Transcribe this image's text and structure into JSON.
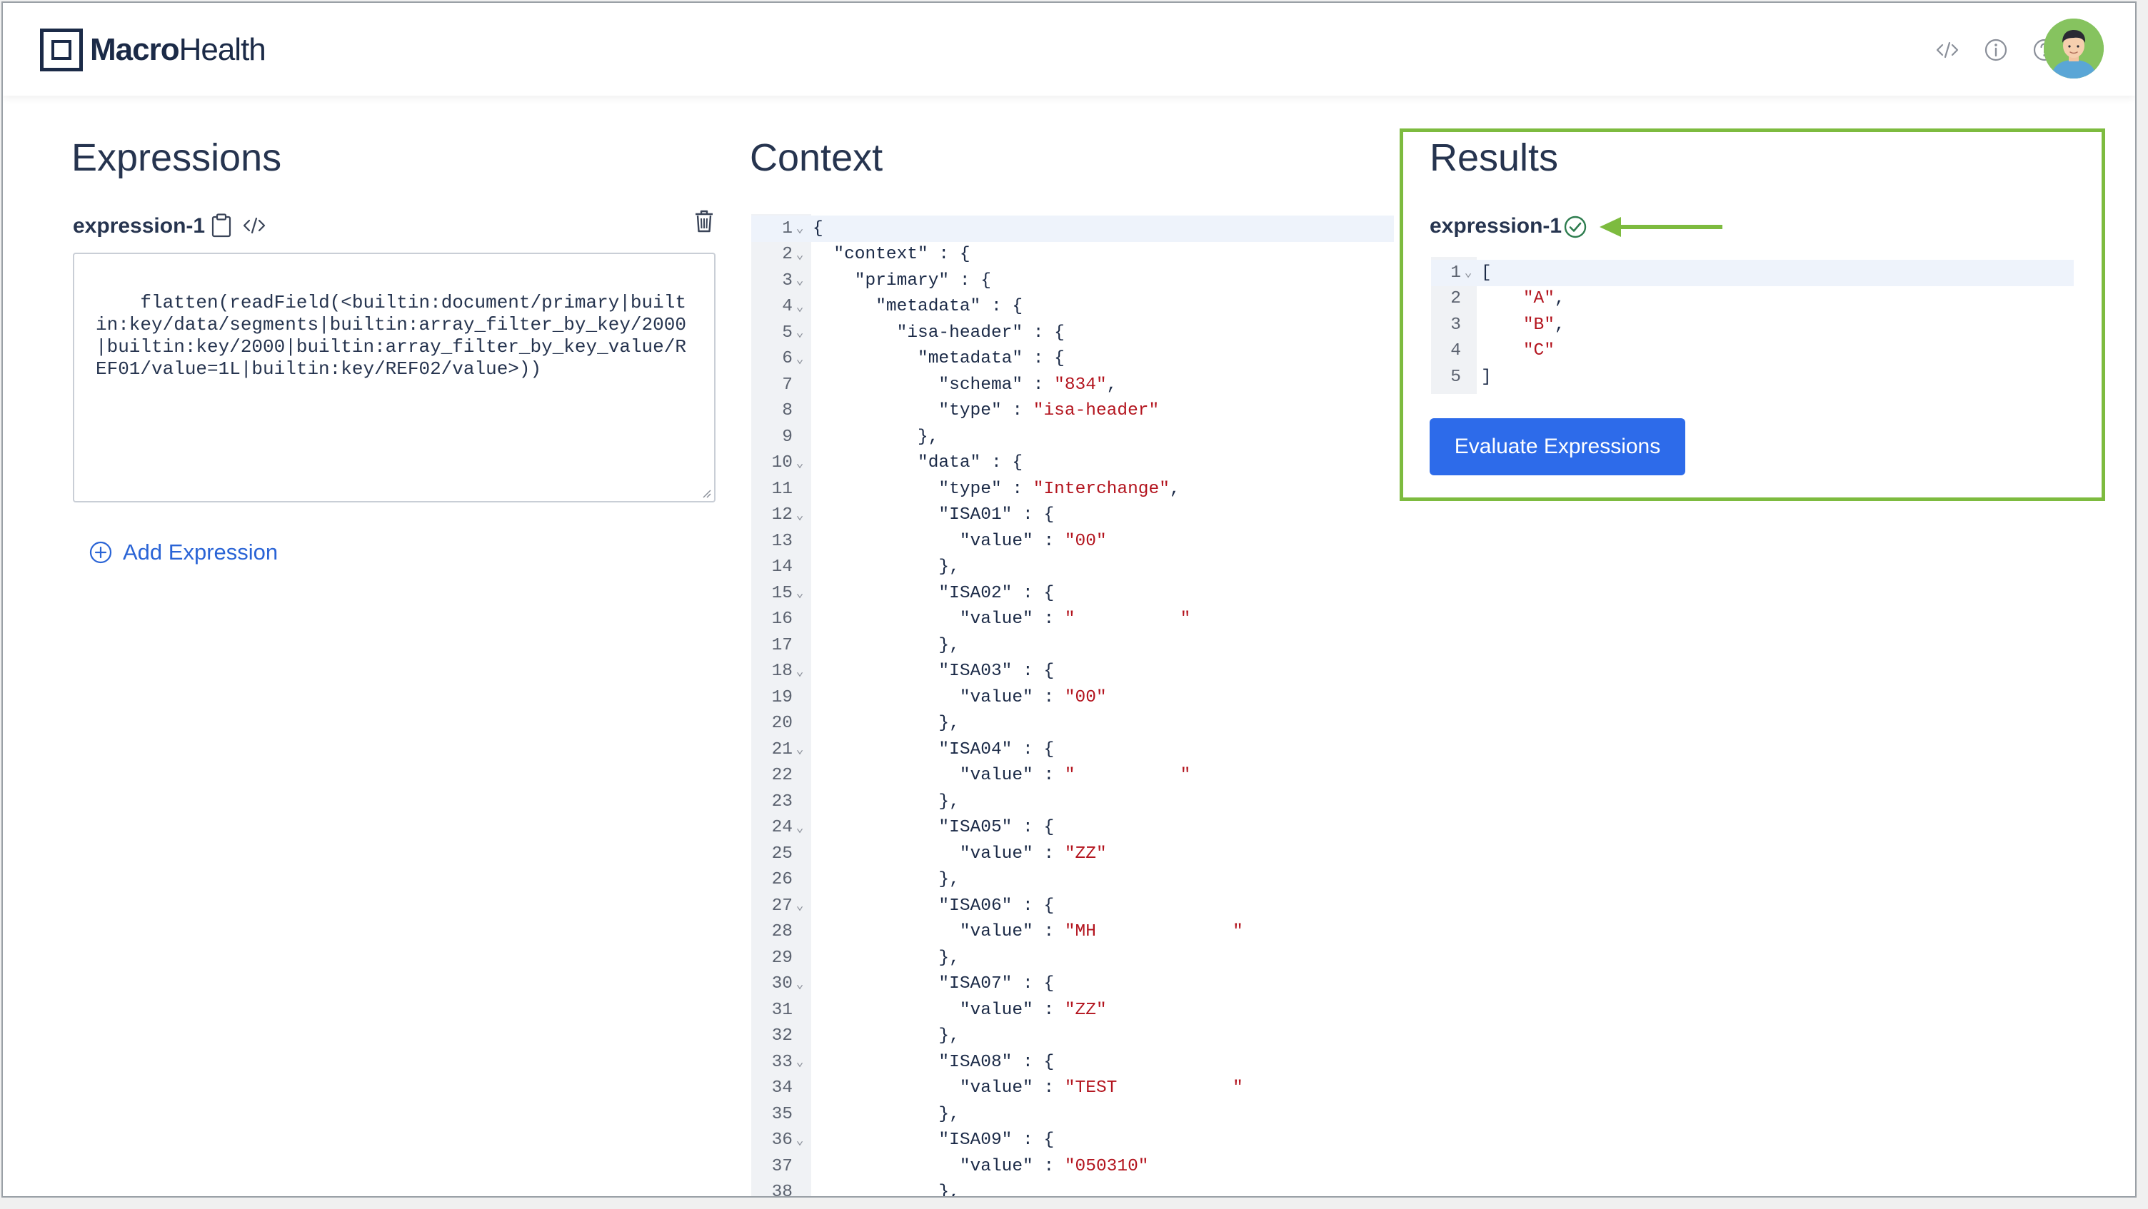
{
  "brand": {
    "name_bold": "Macro",
    "name_regular": "Health"
  },
  "topbar": {
    "icons": [
      "code-icon",
      "info-icon",
      "help-icon"
    ]
  },
  "expressions": {
    "title": "Expressions",
    "items": [
      {
        "label": "expression-1",
        "text": "flatten(readField(<builtin:document/primary|builtin:key/data/segments|builtin:array_filter_by_key/2000|builtin:key/2000|builtin:array_filter_by_key_value/REF01/value=1L|builtin:key/REF02/value>))"
      }
    ],
    "add_label": "Add Expression"
  },
  "context": {
    "title": "Context",
    "lines": [
      {
        "n": "1",
        "f": true,
        "segs": [
          [
            "p",
            "{"
          ]
        ]
      },
      {
        "n": "2",
        "f": true,
        "segs": [
          [
            "p",
            "  \"context\" : {"
          ]
        ]
      },
      {
        "n": "3",
        "f": true,
        "segs": [
          [
            "p",
            "    \"primary\" : {"
          ]
        ]
      },
      {
        "n": "4",
        "f": true,
        "segs": [
          [
            "p",
            "      \"metadata\" : {"
          ]
        ]
      },
      {
        "n": "5",
        "f": true,
        "segs": [
          [
            "p",
            "        \"isa-header\" : {"
          ]
        ]
      },
      {
        "n": "6",
        "f": true,
        "segs": [
          [
            "p",
            "          \"metadata\" : {"
          ]
        ]
      },
      {
        "n": "7",
        "f": false,
        "segs": [
          [
            "p",
            "            \"schema\" : "
          ],
          [
            "s",
            "\"834\""
          ],
          [
            "p",
            ","
          ]
        ]
      },
      {
        "n": "8",
        "f": false,
        "segs": [
          [
            "p",
            "            \"type\" : "
          ],
          [
            "s",
            "\"isa-header\""
          ]
        ]
      },
      {
        "n": "9",
        "f": false,
        "segs": [
          [
            "p",
            "          },"
          ]
        ]
      },
      {
        "n": "10",
        "f": true,
        "segs": [
          [
            "p",
            "          \"data\" : {"
          ]
        ]
      },
      {
        "n": "11",
        "f": false,
        "segs": [
          [
            "p",
            "            \"type\" : "
          ],
          [
            "s",
            "\"Interchange\""
          ],
          [
            "p",
            ","
          ]
        ]
      },
      {
        "n": "12",
        "f": true,
        "segs": [
          [
            "p",
            "            \"ISA01\" : {"
          ]
        ]
      },
      {
        "n": "13",
        "f": false,
        "segs": [
          [
            "p",
            "              \"value\" : "
          ],
          [
            "s",
            "\"00\""
          ]
        ]
      },
      {
        "n": "14",
        "f": false,
        "segs": [
          [
            "p",
            "            },"
          ]
        ]
      },
      {
        "n": "15",
        "f": true,
        "segs": [
          [
            "p",
            "            \"ISA02\" : {"
          ]
        ]
      },
      {
        "n": "16",
        "f": false,
        "segs": [
          [
            "p",
            "              \"value\" : "
          ],
          [
            "s",
            "\"          \""
          ]
        ]
      },
      {
        "n": "17",
        "f": false,
        "segs": [
          [
            "p",
            "            },"
          ]
        ]
      },
      {
        "n": "18",
        "f": true,
        "segs": [
          [
            "p",
            "            \"ISA03\" : {"
          ]
        ]
      },
      {
        "n": "19",
        "f": false,
        "segs": [
          [
            "p",
            "              \"value\" : "
          ],
          [
            "s",
            "\"00\""
          ]
        ]
      },
      {
        "n": "20",
        "f": false,
        "segs": [
          [
            "p",
            "            },"
          ]
        ]
      },
      {
        "n": "21",
        "f": true,
        "segs": [
          [
            "p",
            "            \"ISA04\" : {"
          ]
        ]
      },
      {
        "n": "22",
        "f": false,
        "segs": [
          [
            "p",
            "              \"value\" : "
          ],
          [
            "s",
            "\"          \""
          ]
        ]
      },
      {
        "n": "23",
        "f": false,
        "segs": [
          [
            "p",
            "            },"
          ]
        ]
      },
      {
        "n": "24",
        "f": true,
        "segs": [
          [
            "p",
            "            \"ISA05\" : {"
          ]
        ]
      },
      {
        "n": "25",
        "f": false,
        "segs": [
          [
            "p",
            "              \"value\" : "
          ],
          [
            "s",
            "\"ZZ\""
          ]
        ]
      },
      {
        "n": "26",
        "f": false,
        "segs": [
          [
            "p",
            "            },"
          ]
        ]
      },
      {
        "n": "27",
        "f": true,
        "segs": [
          [
            "p",
            "            \"ISA06\" : {"
          ]
        ]
      },
      {
        "n": "28",
        "f": false,
        "segs": [
          [
            "p",
            "              \"value\" : "
          ],
          [
            "s",
            "\"MH             \""
          ]
        ]
      },
      {
        "n": "29",
        "f": false,
        "segs": [
          [
            "p",
            "            },"
          ]
        ]
      },
      {
        "n": "30",
        "f": true,
        "segs": [
          [
            "p",
            "            \"ISA07\" : {"
          ]
        ]
      },
      {
        "n": "31",
        "f": false,
        "segs": [
          [
            "p",
            "              \"value\" : "
          ],
          [
            "s",
            "\"ZZ\""
          ]
        ]
      },
      {
        "n": "32",
        "f": false,
        "segs": [
          [
            "p",
            "            },"
          ]
        ]
      },
      {
        "n": "33",
        "f": true,
        "segs": [
          [
            "p",
            "            \"ISA08\" : {"
          ]
        ]
      },
      {
        "n": "34",
        "f": false,
        "segs": [
          [
            "p",
            "              \"value\" : "
          ],
          [
            "s",
            "\"TEST           \""
          ]
        ]
      },
      {
        "n": "35",
        "f": false,
        "segs": [
          [
            "p",
            "            },"
          ]
        ]
      },
      {
        "n": "36",
        "f": true,
        "segs": [
          [
            "p",
            "            \"ISA09\" : {"
          ]
        ]
      },
      {
        "n": "37",
        "f": false,
        "segs": [
          [
            "p",
            "              \"value\" : "
          ],
          [
            "s",
            "\"050310\""
          ]
        ]
      },
      {
        "n": "38",
        "f": false,
        "segs": [
          [
            "p",
            "            },"
          ]
        ]
      }
    ]
  },
  "results": {
    "title": "Results",
    "items": [
      {
        "label": "expression-1",
        "status": "success",
        "lines": [
          {
            "n": "1",
            "f": true,
            "segs": [
              [
                "p",
                "["
              ]
            ]
          },
          {
            "n": "2",
            "f": false,
            "segs": [
              [
                "p",
                "    "
              ],
              [
                "s",
                "\"A\""
              ],
              [
                "p",
                ","
              ]
            ]
          },
          {
            "n": "3",
            "f": false,
            "segs": [
              [
                "p",
                "    "
              ],
              [
                "s",
                "\"B\""
              ],
              [
                "p",
                ","
              ]
            ]
          },
          {
            "n": "4",
            "f": false,
            "segs": [
              [
                "p",
                "    "
              ],
              [
                "s",
                "\"C\""
              ]
            ]
          },
          {
            "n": "5",
            "f": false,
            "segs": [
              [
                "p",
                "]"
              ]
            ]
          }
        ]
      }
    ],
    "evaluate_label": "Evaluate Expressions"
  },
  "colors": {
    "accent": "#2d6bea",
    "highlight_border": "#7dbb3f",
    "string": "#b3141e",
    "text": "#26344f"
  }
}
